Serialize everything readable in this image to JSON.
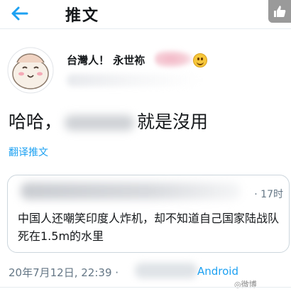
{
  "header": {
    "title": "推文"
  },
  "author": {
    "name_visible": "台灣人！ 永世袮"
  },
  "tweet": {
    "text_before": "哈哈，",
    "text_after": "就是沒用",
    "translate": "翻译推文"
  },
  "quote": {
    "time": "· 17时",
    "text": "中国人还嘲笑印度人炸机，却不知道自己国家陆战队死在1.5m的水里"
  },
  "footer": {
    "timestamp": "20年7月12日, 22:39 ·",
    "source": "Android"
  },
  "colors": {
    "link": "#1da1f2",
    "muted": "#657786",
    "border": "#ccd6dd"
  }
}
